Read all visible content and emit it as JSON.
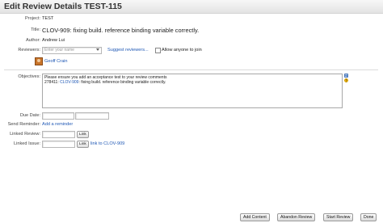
{
  "header": {
    "title": "Edit Review Details TEST-115"
  },
  "form": {
    "project": {
      "label": "Project:",
      "value": "TEST"
    },
    "title": {
      "label": "Title:",
      "key": "CLOV-909",
      "text": ": fixing build. reference binding variable correctly."
    },
    "author": {
      "label": "Author:",
      "value": "Andrew Lui"
    },
    "reviewers": {
      "label": "Reviewers:",
      "placeholder": "Enter your name",
      "suggest_link": "Suggest reviewers...",
      "allow_anyone_label": "Allow anyone to join",
      "listed_reviewer": "Geoff Crain"
    },
    "objectives": {
      "label": "Objectives:",
      "line1": "Please ensure you add an acceptance test to your review comments",
      "line2_prefix": "278411: ",
      "line2_key": "CLOV-909",
      "line2_suffix": ": fixing build. reference binding variable correctly."
    },
    "due_date": {
      "label": "Due Date:"
    },
    "send_reminder": {
      "label": "Send Reminder:",
      "link": "Add a reminder"
    },
    "linked_review": {
      "label": "Linked Review:",
      "button": "Link"
    },
    "linked_issue": {
      "label": "Linked Issue:",
      "button": "Link",
      "link": "link to CLOV-909"
    }
  },
  "footer": {
    "add_content": "Add Content",
    "abandon_review": "Abandon Review",
    "start_review": "Start Review",
    "done": "Done"
  },
  "icons": {
    "wiki_icon": "wiki-markup-icon",
    "help_icon": "help-icon",
    "avatar": "user-avatar"
  },
  "colors": {
    "link": "#1f58b5",
    "header_bg": "#e8e8e8",
    "help_icon": "#f2b90f",
    "wiki_icon": "#5a87c8"
  }
}
